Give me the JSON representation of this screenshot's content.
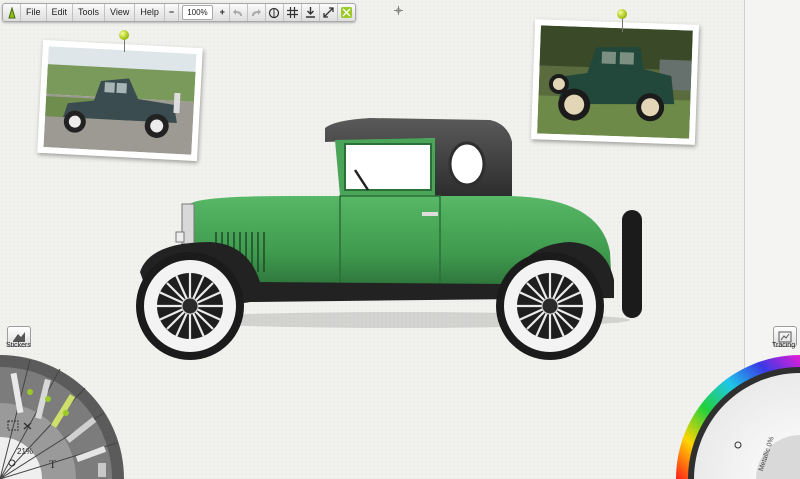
{
  "menu": {
    "app_icon": "brush-icon",
    "items": [
      {
        "label": "File"
      },
      {
        "label": "Edit"
      },
      {
        "label": "Tools"
      },
      {
        "label": "View"
      },
      {
        "label": "Help"
      }
    ],
    "zoom_out": "−",
    "zoom_value": "100%",
    "zoom_in": "+",
    "toolbar_icons": [
      "undo-icon",
      "redo-icon",
      "symmetry-icon",
      "grid-icon",
      "export-icon",
      "fullscreen-icon",
      "collapse-icon"
    ]
  },
  "left_panel": {
    "stickers_label": "Stickers",
    "zoom_percent": "21%",
    "text_tool_glyph": "T"
  },
  "right_panel": {
    "tracing_label": "Tracing",
    "metallic_label": "Metallic 0%"
  },
  "colors": {
    "canvas": "#f1f1ee",
    "car_body": "#3f9a4e",
    "car_body_dark": "#2b6e38",
    "roof": "#3d3d3d",
    "pin": "#a5c417"
  }
}
